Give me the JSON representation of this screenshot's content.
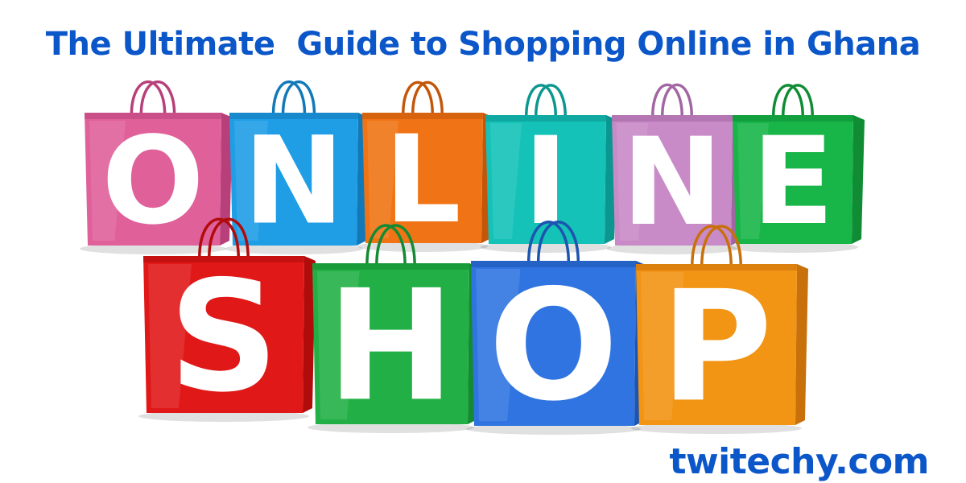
{
  "title": "The Ultimate  Guide to Shopping Online in Ghana",
  "brand": "twitechy.com",
  "rows": [
    {
      "bags": [
        {
          "letter": "O",
          "color": "#e0609a",
          "dark": "#b8407a"
        },
        {
          "letter": "N",
          "color": "#1f9ee6",
          "dark": "#1279b8"
        },
        {
          "letter": "L",
          "color": "#f07415",
          "dark": "#c4560a"
        },
        {
          "letter": "I",
          "color": "#14c2b8",
          "dark": "#0b9690"
        },
        {
          "letter": "N",
          "color": "#c98ac8",
          "dark": "#a266a3"
        },
        {
          "letter": "E",
          "color": "#18b548",
          "dark": "#0f8c34"
        }
      ]
    },
    {
      "bags": [
        {
          "letter": "S",
          "color": "#e01818",
          "dark": "#b00c0c"
        },
        {
          "letter": "H",
          "color": "#22b046",
          "dark": "#148a32"
        },
        {
          "letter": "O",
          "color": "#2f74e0",
          "dark": "#1d54b0"
        },
        {
          "letter": "P",
          "color": "#f29414",
          "dark": "#c8700a"
        }
      ]
    }
  ]
}
